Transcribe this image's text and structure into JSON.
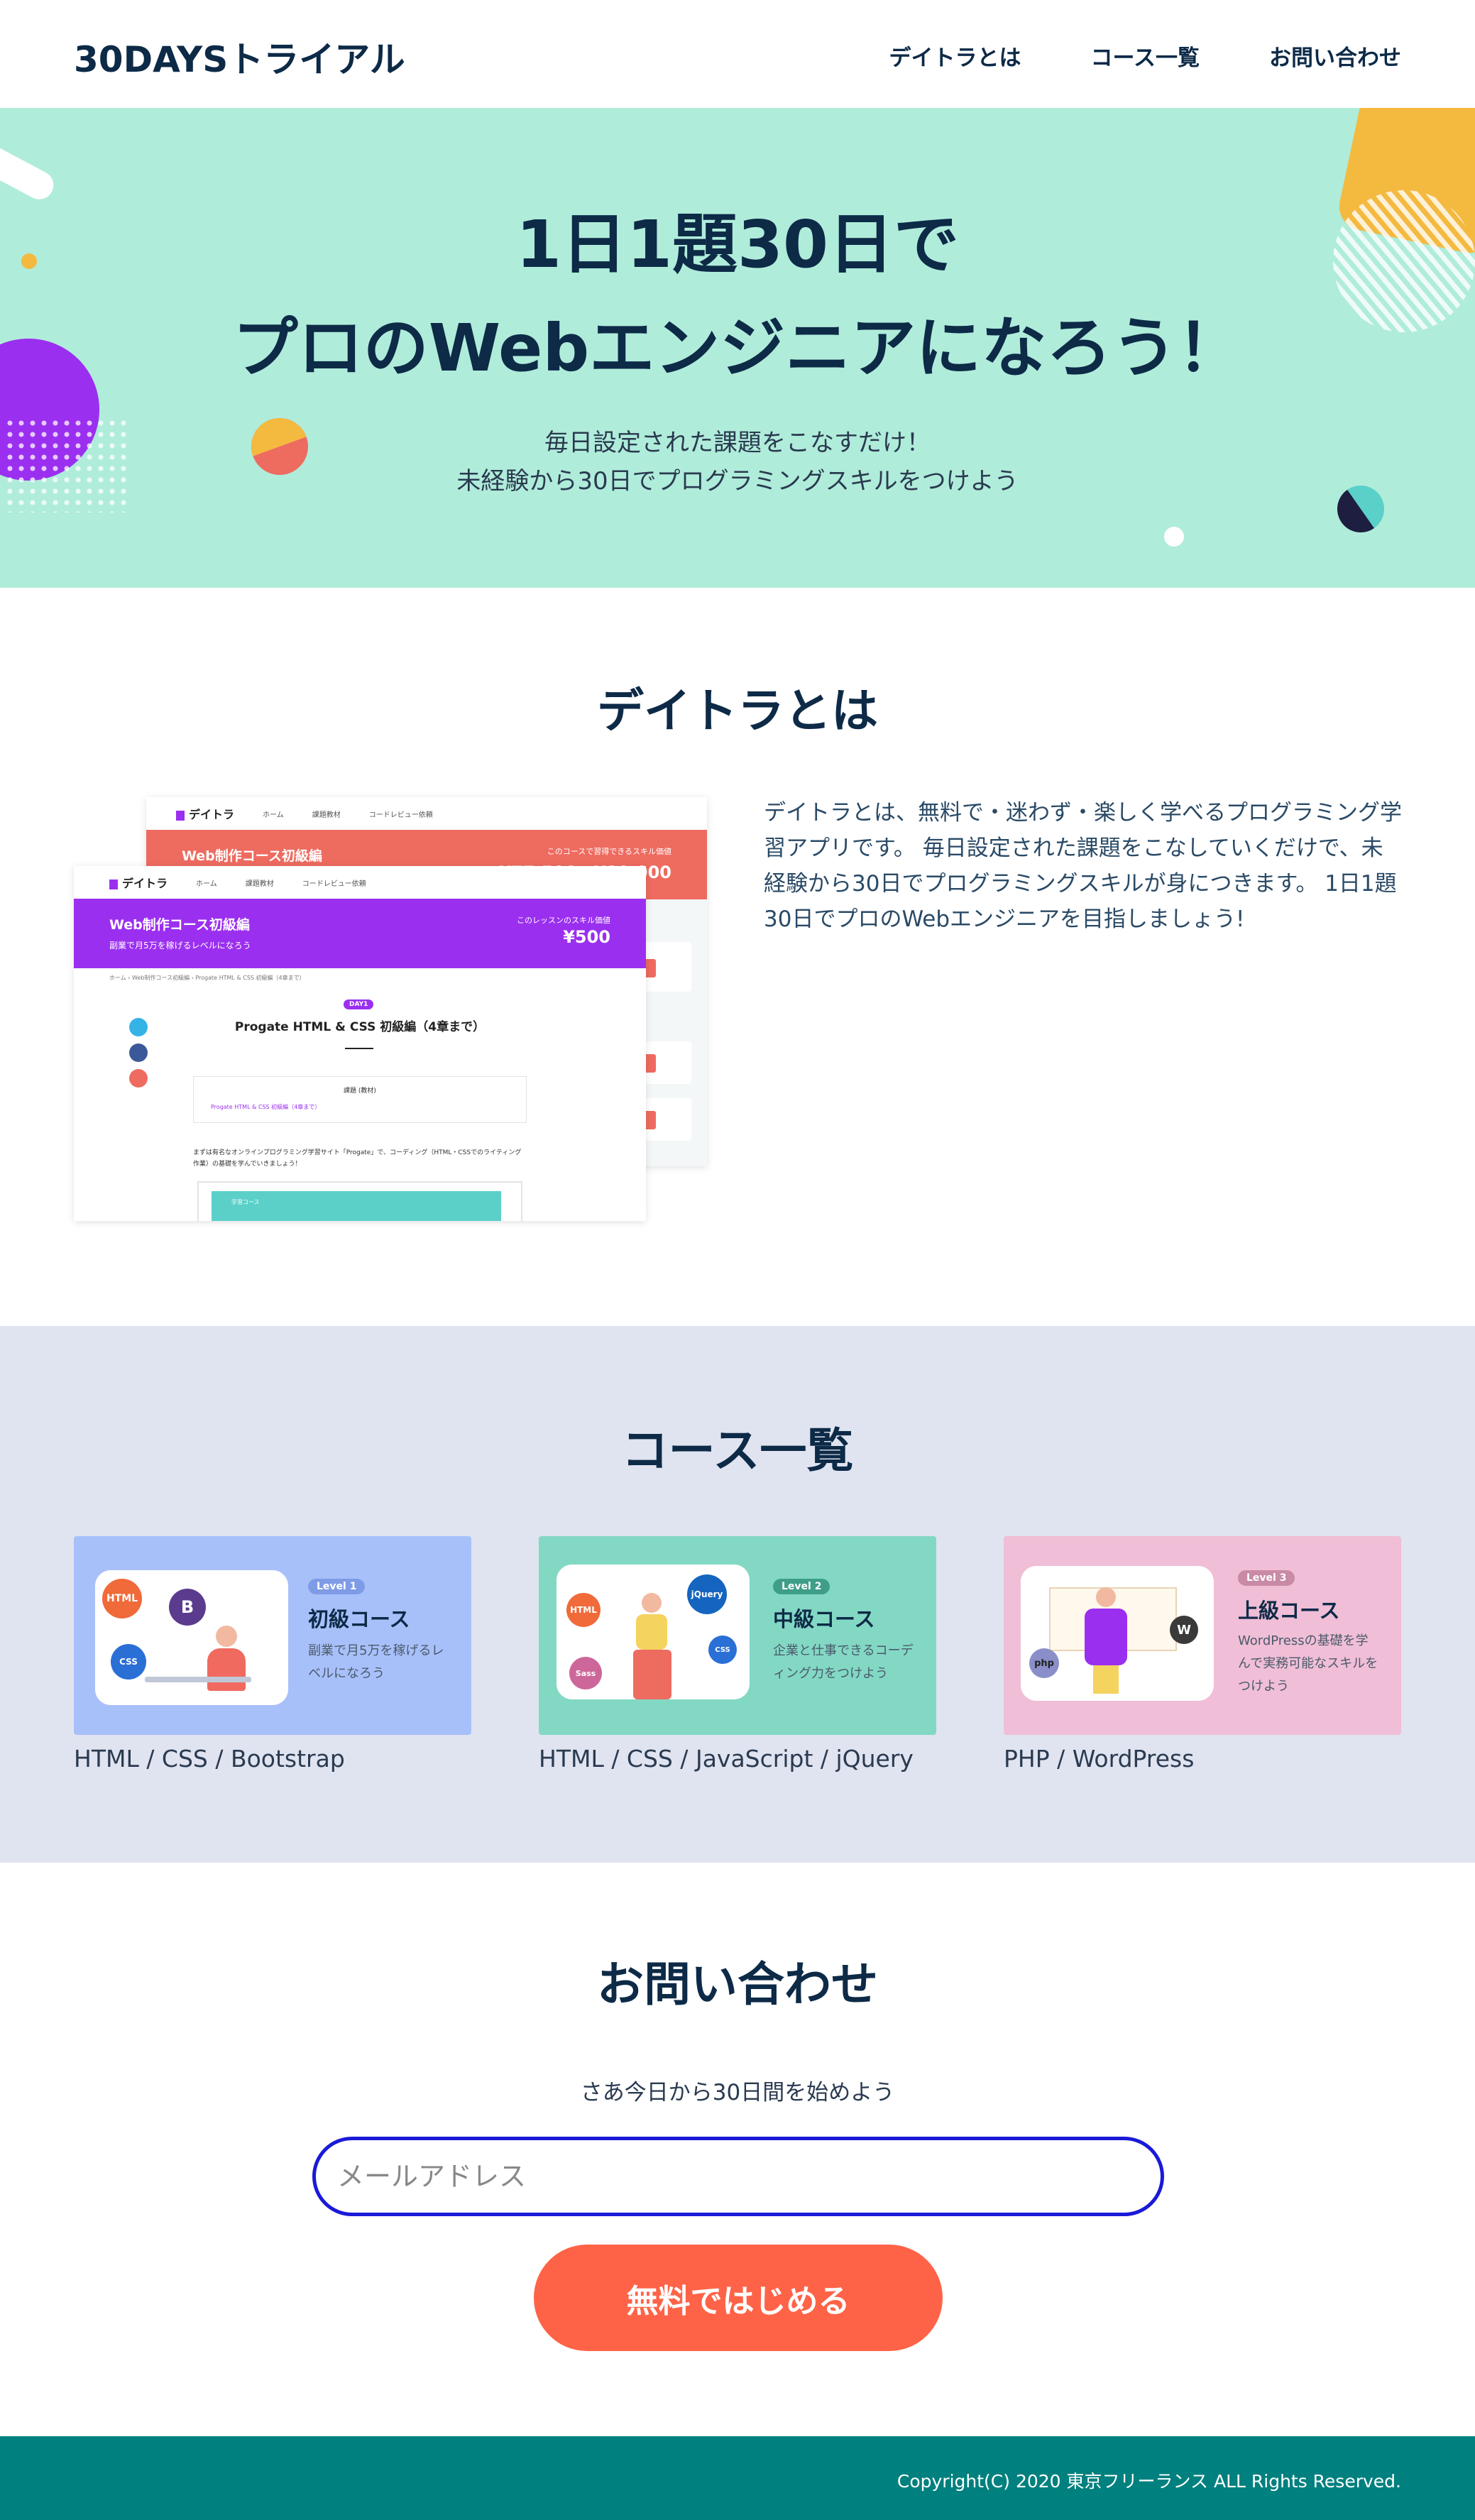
{
  "header": {
    "logo": "30DAYSトライアル",
    "nav": [
      "デイトラとは",
      "コース一覧",
      "お問い合わせ"
    ]
  },
  "hero": {
    "title_line1": "1日1題30日で",
    "title_line2": "プロのWebエンジニアになろう！",
    "sub_line1": "毎日設定された課題をこなすだけ！",
    "sub_line2": "未経験から30日でプログラミングスキルをつけよう"
  },
  "about": {
    "title": "デイトラとは",
    "text": "デイトラとは、無料で・迷わず・楽しく学べるプログラミング学習アプリです。 毎日設定された課題をこなしていくだけで、未経験から30日でプログラミングスキルが身につきます。 1日1題30日でプロのWebエンジニアを目指しましょう!",
    "mock_back": {
      "brand": "デイトラ",
      "nav": [
        "ホーム",
        "課題教材",
        "コードレビュー依頼"
      ],
      "banner_title": "Web制作コース初級編",
      "banner_right": "このコースで習得できるスキル価値",
      "banner_value": "¥77,500〜¥80,000"
    },
    "mock_front": {
      "brand": "デイトラ",
      "nav": [
        "ホーム",
        "課題教材",
        "コードレビュー依頼"
      ],
      "banner_title": "Web制作コース初級編",
      "banner_sub": "副業で月5万を稼げるレベルになろう",
      "banner_right": "このレッスンのスキル価値",
      "banner_value": "¥500",
      "breadcrumb": "ホーム  ›  Web制作コース初級編  ›  Progate HTML & CSS 初級編（4章まで）",
      "day_badge": "DAY1",
      "lesson_title": "Progate HTML & CSS 初級編（4章まで）",
      "box_label": "課題 (教材)",
      "box_link": "Progate HTML & CSS 初級編（4章まで）",
      "body_text": "まずは有名なオンラインプログラミング学習サイト「Progate」で、コーディング（HTML・CSSでのライティング作業）の基礎を学んでいきましょう！",
      "inner_label": "学習コース"
    }
  },
  "courses": {
    "title": "コース一覧",
    "items": [
      {
        "level": "Level 1",
        "name": "初級コース",
        "desc": "副業で月5万を稼げるレベルになろう",
        "tech": "HTML / CSS / Bootstrap",
        "bg": "#a8c0fa",
        "badge": "#7f9be6",
        "icons": [
          "HTML",
          "B",
          "CSS"
        ]
      },
      {
        "level": "Level 2",
        "name": "中級コース",
        "desc": "企業と仕事できるコーディング力をつけよう",
        "tech": "HTML / CSS / JavaScript / jQuery",
        "bg": "#83d8c4",
        "badge": "#3e9e88",
        "icons": [
          "HTML",
          "jQuery",
          "Sass",
          "CSS"
        ]
      },
      {
        "level": "Level 3",
        "name": "上級コース",
        "desc": "WordPressの基礎を学んで実務可能なスキルをつけよう",
        "tech": "PHP / WordPress",
        "bg": "#f0bed6",
        "badge": "#c98aa6",
        "icons": [
          "php",
          "W"
        ]
      }
    ]
  },
  "contact": {
    "title": "お問い合わせ",
    "lead": "さあ今日から30日間を始めよう",
    "email_placeholder": "メールアドレス",
    "cta": "無料ではじめる"
  },
  "footer": {
    "copyright": "Copyright(C) 2020 東京フリーランス ALL Rights Reserved."
  },
  "colors": {
    "navy": "#0d2a47",
    "hero_bg": "#b0ecda",
    "courses_bg": "#e0e4f0",
    "cta": "#ff6347",
    "footer": "#00807e",
    "mock_red": "#ee6b60",
    "mock_purple": "#9b2ff0"
  }
}
